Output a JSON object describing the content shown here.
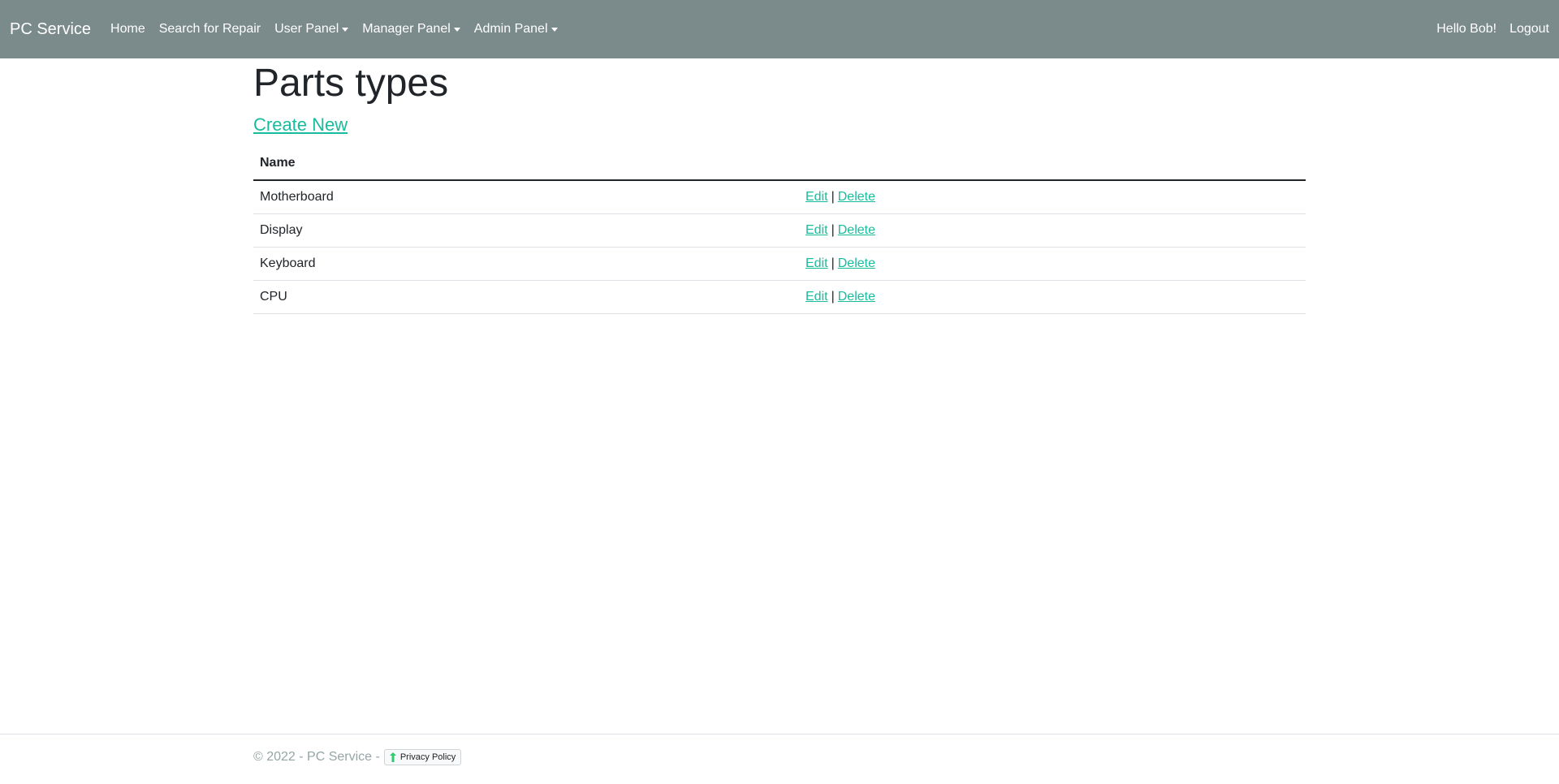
{
  "navbar": {
    "brand": "PC Service",
    "links": [
      "Home",
      "Search for Repair"
    ],
    "dropdowns": [
      "User Panel",
      "Manager Panel",
      "Admin Panel"
    ],
    "greeting": "Hello Bob!",
    "logout": "Logout"
  },
  "page": {
    "title": "Parts types",
    "create_link": "Create New"
  },
  "table": {
    "header": "Name",
    "rows": [
      {
        "name": "Motherboard",
        "edit": "Edit",
        "sep": "|",
        "delete": "Delete"
      },
      {
        "name": "Display",
        "edit": "Edit",
        "sep": "|",
        "delete": "Delete"
      },
      {
        "name": "Keyboard",
        "edit": "Edit",
        "sep": "|",
        "delete": "Delete"
      },
      {
        "name": "CPU",
        "edit": "Edit",
        "sep": "|",
        "delete": "Delete"
      }
    ]
  },
  "footer": {
    "copyright": "© 2022 - PC Service -",
    "privacy": "Privacy Policy"
  },
  "colors": {
    "navbar_bg": "#7b8a8b",
    "link": "#18bc9c",
    "footer_text": "#95a5a6"
  }
}
